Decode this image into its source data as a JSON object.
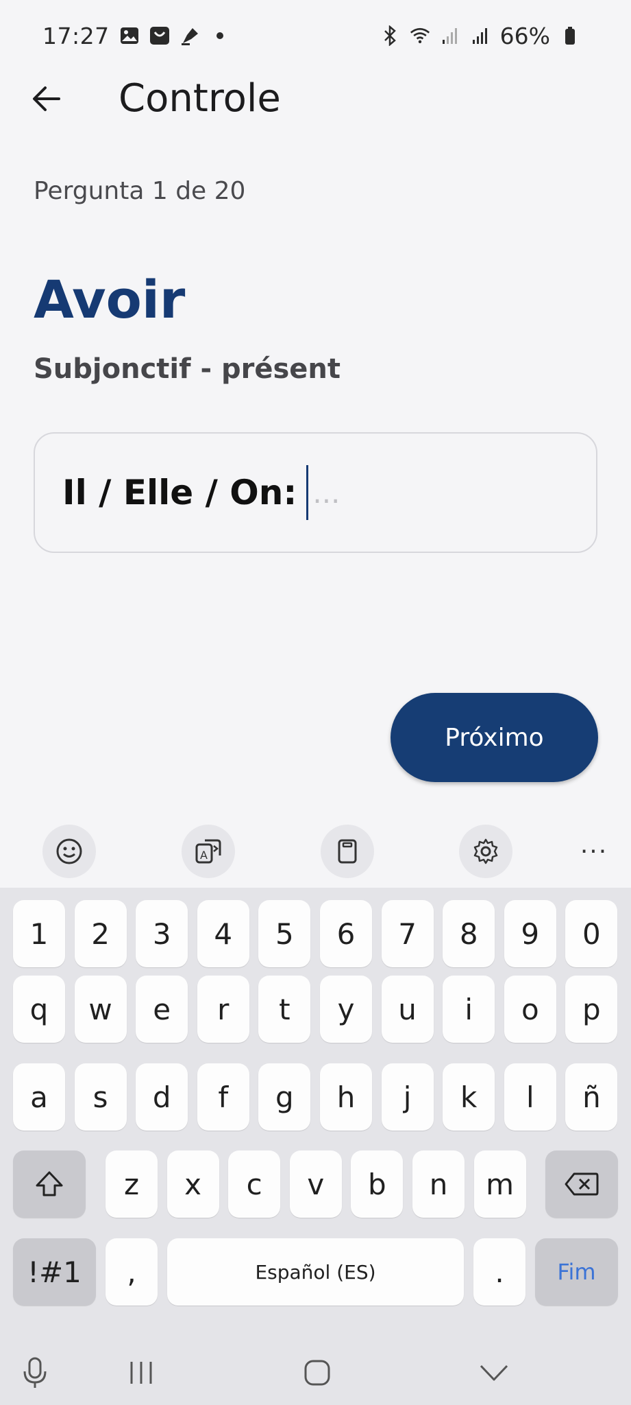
{
  "status_bar": {
    "time": "17:27",
    "battery": "66%",
    "left_icons": [
      "gallery-icon",
      "shopping-bag-icon",
      "pen-icon",
      "dot-icon"
    ],
    "right_icons": [
      "bluetooth-icon",
      "wifi-icon",
      "signal-icon",
      "signal-icon",
      "battery-icon"
    ]
  },
  "app_bar": {
    "title": "Controle"
  },
  "quiz": {
    "counter": "Pergunta 1 de 20",
    "verb": "Avoir",
    "tense": "Subjonctif - présent",
    "pronoun": "Il / Elle / On:",
    "input_value": "",
    "input_placeholder": "...",
    "next_label": "Próximo"
  },
  "colors": {
    "primary": "#163d74",
    "background": "#f5f5f7",
    "keyboard_bg": "#e4e4e8",
    "fim_blue": "#3b73d6"
  },
  "keyboard": {
    "toolbar": [
      "emoji-icon",
      "translate-icon",
      "clipboard-icon",
      "settings-icon",
      "more-icon"
    ],
    "more_label": "···",
    "row_numbers": [
      "1",
      "2",
      "3",
      "4",
      "5",
      "6",
      "7",
      "8",
      "9",
      "0"
    ],
    "row1": [
      "q",
      "w",
      "e",
      "r",
      "t",
      "y",
      "u",
      "i",
      "o",
      "p"
    ],
    "row2": [
      "a",
      "s",
      "d",
      "f",
      "g",
      "h",
      "j",
      "k",
      "l",
      "ñ"
    ],
    "row3": [
      "z",
      "x",
      "c",
      "v",
      "b",
      "n",
      "m"
    ],
    "symbols_label": "!#1",
    "comma_label": ",",
    "space_label": "Español (ES)",
    "period_label": ".",
    "done_label": "Fim"
  },
  "nav_bar": [
    "microphone-icon",
    "recent-apps-icon",
    "home-icon",
    "collapse-keyboard-icon"
  ]
}
